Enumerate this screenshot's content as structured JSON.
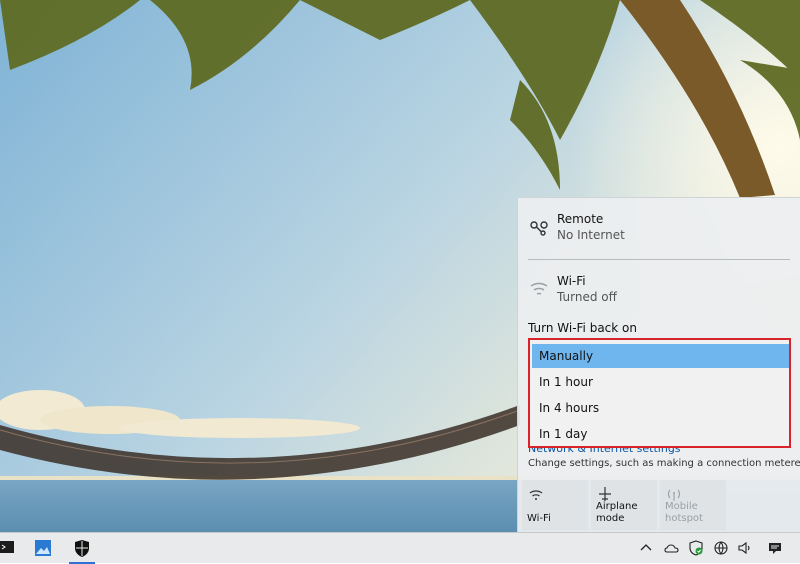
{
  "network_flyout": {
    "connections": [
      {
        "name": "Remote",
        "status": "No Internet",
        "icon": "ethernet-icon"
      },
      {
        "name": "Wi-Fi",
        "status": "Turned off",
        "icon": "wifi-icon"
      }
    ],
    "wifi_back_on_label": "Turn Wi-Fi back on",
    "wifi_back_on_options": [
      "Manually",
      "In 1 hour",
      "In 4 hours",
      "In 1 day"
    ],
    "selected_option": "Manually",
    "settings_link": "Network & Internet settings",
    "settings_description": "Change settings, such as making a connection metered.",
    "quick_actions": [
      {
        "label": "Wi-Fi",
        "icon": "wifi-icon",
        "enabled": true
      },
      {
        "label": "Airplane mode",
        "icon": "airplane-icon",
        "enabled": true
      },
      {
        "label": "Mobile hotspot",
        "icon": "hotspot-icon",
        "enabled": false
      }
    ]
  },
  "taskbar": {
    "apps": [
      "terminal-icon",
      "photos-icon",
      "windows-security-icon"
    ],
    "tray_icons": [
      "chevron-up-icon",
      "onedrive-icon",
      "defender-icon",
      "network-icon",
      "globe-icon",
      "volume-icon",
      "notification-icon"
    ]
  },
  "colors": {
    "selection": "#6fb6ef",
    "highlight_border": "#d8232a",
    "link": "#0b57a4"
  }
}
